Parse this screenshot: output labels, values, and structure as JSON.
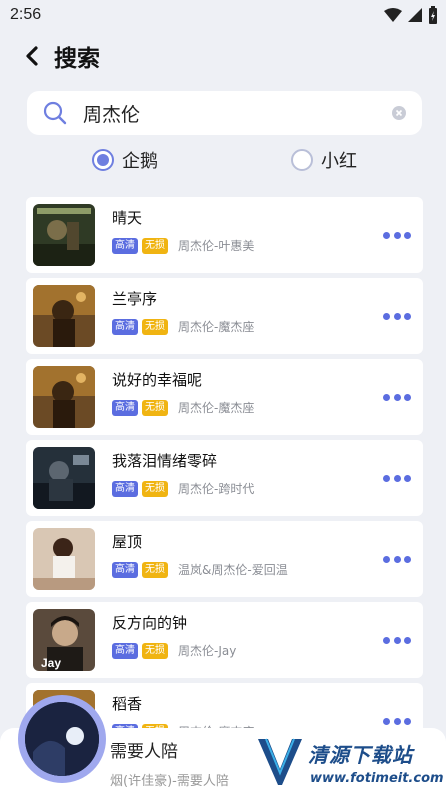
{
  "status_bar": {
    "time": "2:56"
  },
  "header": {
    "title": "搜索"
  },
  "search": {
    "query": "周杰伦"
  },
  "sources": [
    {
      "label": "企鹅",
      "selected": true
    },
    {
      "label": "小红",
      "selected": false
    }
  ],
  "songs": [
    {
      "title": "晴天",
      "tag_hd": "高清",
      "tag_lossless": "无损",
      "artist": "周杰伦-叶惠美"
    },
    {
      "title": "兰亭序",
      "tag_hd": "高清",
      "tag_lossless": "无损",
      "artist": "周杰伦-魔杰座"
    },
    {
      "title": "说好的幸福呢",
      "tag_hd": "高清",
      "tag_lossless": "无损",
      "artist": "周杰伦-魔杰座"
    },
    {
      "title": "我落泪情绪零碎",
      "tag_hd": "高清",
      "tag_lossless": "无损",
      "artist": "周杰伦-跨时代"
    },
    {
      "title": "屋顶",
      "tag_hd": "高清",
      "tag_lossless": "无损",
      "artist": "温岚&周杰伦-爱回温"
    },
    {
      "title": "反方向的钟",
      "tag_hd": "高清",
      "tag_lossless": "无损",
      "artist": "周杰伦-Jay"
    },
    {
      "title": "稻香",
      "tag_hd": "高清",
      "tag_lossless": "无损",
      "artist": "周杰伦-魔杰座"
    }
  ],
  "cover_texts": {
    "jay": "Jay"
  },
  "now_playing": {
    "title": "需要人陪",
    "subtitle": "烟(许佳豪)-需要人陪"
  },
  "watermark": {
    "name": "清源下载站",
    "url": "www.fotimeit.com"
  },
  "colors": {
    "accent": "#5b6de0",
    "lossless": "#f0b412",
    "background": "#eef0f5"
  }
}
